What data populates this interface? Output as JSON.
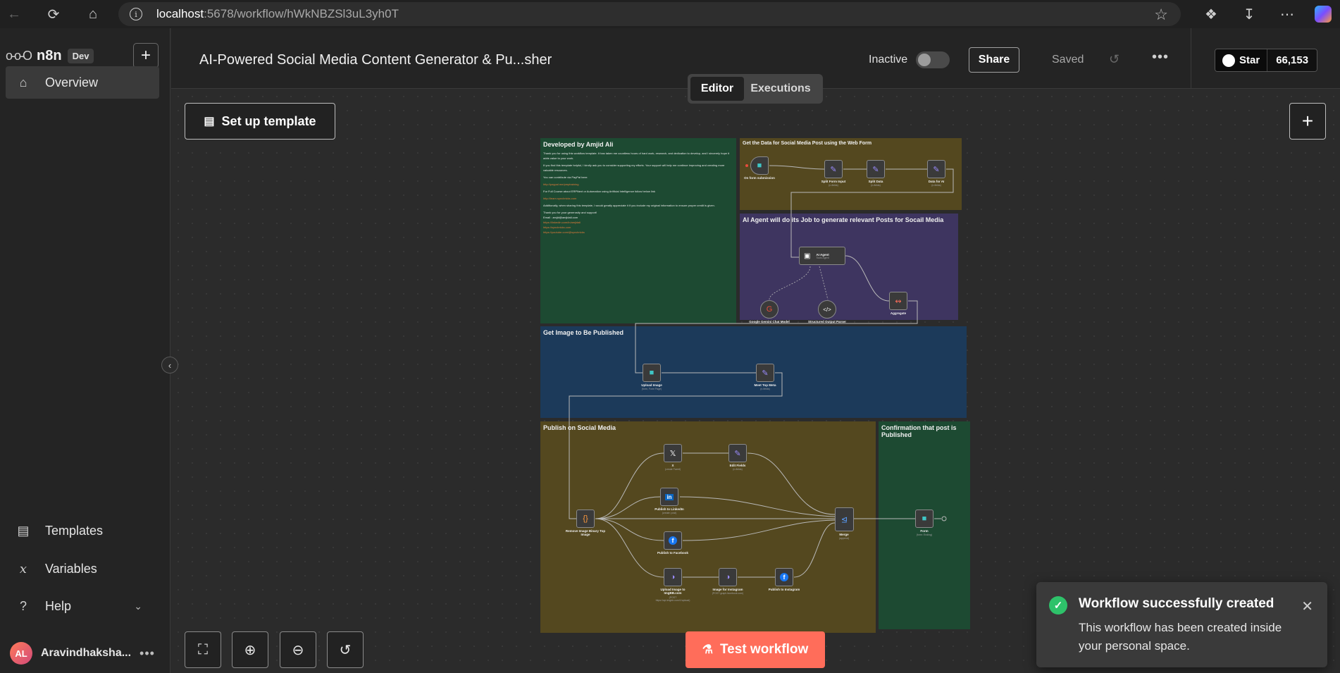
{
  "browser": {
    "url_host": "localhost",
    "url_rest": ":5678/workflow/hWkNBZSl3uL3yh0T"
  },
  "sidebar": {
    "brand": "n8n",
    "env_badge": "Dev",
    "items": [
      {
        "label": "Overview"
      },
      {
        "label": "Templates"
      },
      {
        "label": "Variables"
      },
      {
        "label": "Help"
      }
    ],
    "user": {
      "initials": "AL",
      "name": "Aravindhaksha..."
    }
  },
  "header": {
    "title": "AI-Powered Social Media Content Generator & Pu...sher",
    "status": "Inactive",
    "share": "Share",
    "saved": "Saved",
    "github_star": "Star",
    "github_count": "66,153"
  },
  "tabs": [
    {
      "label": "Editor"
    },
    {
      "label": "Executions"
    }
  ],
  "canvas": {
    "setup_template": "Set up template",
    "test_workflow": "Test workflow",
    "stickies": {
      "developed": {
        "title": "Developed by Amjid Ali",
        "text1": "Thank you for using this workflow template. It has taken me countless hours of hard work, research, and dedication to develop, and I sincerely hope it adds value to your work.",
        "text2": "If you find this template helpful, I kindly ask you to consider supporting my efforts. Your support will help me continue improving and creating more valuable resources.",
        "text3": "You can contribute via PayPal here:",
        "link1": "http://paypal.me/pmptraining",
        "text4": "For Full Course about ERPNext or Automation using Artificial Intelligence follow below link",
        "link2": "http://learn.syncbricks.com",
        "text5": "Additionally, when sharing this template, I would greatly appreciate it if you include my original information to ensure proper credit is given.",
        "text6": "Thank you for your generosity and support!",
        "text7": "Email : amjid@amjidali.com",
        "link3": "https://linkedin.com/in/amjidali",
        "link4": "https://syncbricks.com",
        "link5": "https://youtube.com/@syncbricks"
      },
      "webform": {
        "title": "Get the Data for Social Media Post using the Web Form"
      },
      "agent": {
        "title": "AI Agent will do its Job to generate relevant Posts for Socail Media"
      },
      "image": {
        "title": "Get Image to Be Published"
      },
      "publish": {
        "title": "Publish on Social Media"
      },
      "confirm": {
        "title": "Confirmation that post is Published"
      }
    },
    "nodes": {
      "form_submission": {
        "label": "On form submission"
      },
      "split_form_input": {
        "label": "Split Form Input",
        "sub": "(n-fields)"
      },
      "split_data": {
        "label": "Split Data",
        "sub": "(n-fields)"
      },
      "data_for_ai": {
        "label": "Data for AI",
        "sub": "(n-fields)"
      },
      "ai_agent": {
        "label": "AI Agent",
        "sub": "Tools Agent"
      },
      "gemini": {
        "label": "Google Gemini Chat Model"
      },
      "output_parser": {
        "label": "Structured Output Parser"
      },
      "aggregate": {
        "label": "Aggregate"
      },
      "upload_image": {
        "label": "Upload Image",
        "sub": "(form, Form Page)"
      },
      "meet_top_meta": {
        "label": "Meet Top Meta",
        "sub": "(n-fields)"
      },
      "remove_image_binary": {
        "label": "Remove Image Binary Top Image"
      },
      "x": {
        "label": "X",
        "sub": "(create Tweet)"
      },
      "edit_fields": {
        "label": "Edit Fields",
        "sub": "(n-fields)"
      },
      "publish_linkedin": {
        "label": "Publish to LinkedIn",
        "sub": "(create: post)"
      },
      "publish_facebook": {
        "label": "Publish to Facebook"
      },
      "upload_imgbb": {
        "label": "Upload Image to ImgBB.com",
        "sub": "(POST https://api.imgbb.com/1/upload)"
      },
      "image_instagram": {
        "label": "Image for Instagram",
        "sub": "(POST graph.facebook.com)"
      },
      "publish_instagram": {
        "label": "Publish to Instagram"
      },
      "merge": {
        "label": "Merge",
        "sub": "(append)"
      },
      "form": {
        "label": "Form",
        "sub": "(form: Ending)"
      }
    }
  },
  "toast": {
    "title": "Workflow successfully created",
    "body": "This workflow has been created inside your personal space."
  }
}
